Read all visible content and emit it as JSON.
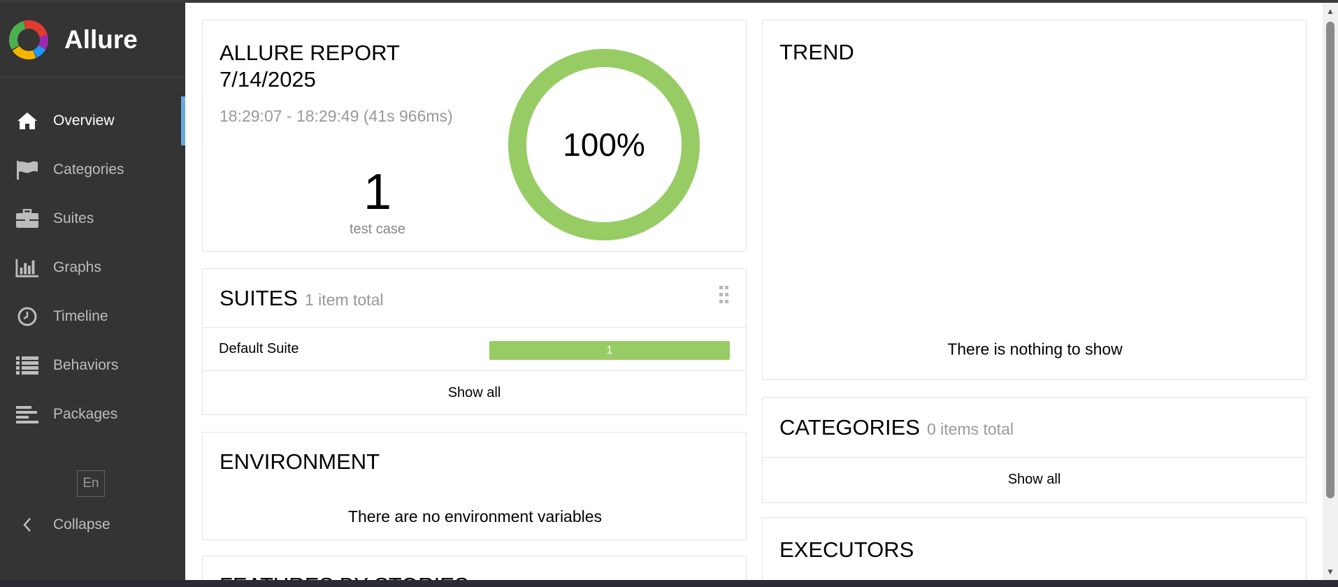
{
  "app": {
    "name": "Allure",
    "logo_colors": [
      "#e03c31",
      "#f7b500",
      "#4caf50",
      "#2196f3",
      "#9c27b0"
    ]
  },
  "sidebar": {
    "items": [
      {
        "label": "Overview",
        "icon": "home-icon",
        "active": true
      },
      {
        "label": "Categories",
        "icon": "flag-icon",
        "active": false
      },
      {
        "label": "Suites",
        "icon": "briefcase-icon",
        "active": false
      },
      {
        "label": "Graphs",
        "icon": "bar-chart-icon",
        "active": false
      },
      {
        "label": "Timeline",
        "icon": "clock-icon",
        "active": false
      },
      {
        "label": "Behaviors",
        "icon": "list-icon",
        "active": false
      },
      {
        "label": "Packages",
        "icon": "align-left-icon",
        "active": false
      }
    ],
    "language": "En",
    "collapse_label": "Collapse"
  },
  "summary": {
    "title_line1": "ALLURE REPORT",
    "title_line2": "7/14/2025",
    "time_range": "18:29:07 - 18:29:49 (41s 966ms)",
    "count": "1",
    "count_label": "test case",
    "percent_label": "100%",
    "pass_fraction": 1.0,
    "pass_color": "#97cc64"
  },
  "suites": {
    "title": "SUITES",
    "subtitle": "1 item total",
    "rows": [
      {
        "name": "Default Suite",
        "count": "1",
        "passed_fraction": 1.0
      }
    ],
    "show_all": "Show all"
  },
  "environment": {
    "title": "ENVIRONMENT",
    "empty_text": "There are no environment variables"
  },
  "features": {
    "title": "FEATURES BY STORIES"
  },
  "trend": {
    "title": "TRENDS",
    "title_display": "TREND",
    "empty_text": "There is nothing to show"
  },
  "categories": {
    "title": "CATEGORIES",
    "subtitle": "0 items total",
    "show_all": "Show all"
  },
  "executors": {
    "title": "EXECUTORS"
  }
}
